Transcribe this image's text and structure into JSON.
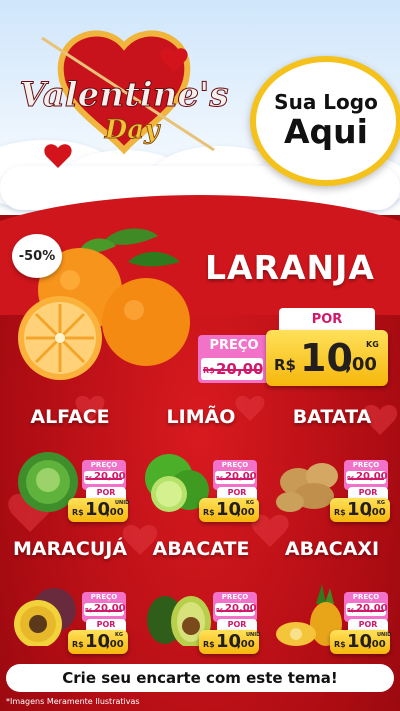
{
  "header": {
    "title_line1": "Valentine's",
    "title_line2": "Day",
    "logo_line1": "Sua Logo",
    "logo_line2": "Aqui"
  },
  "hero": {
    "discount": "-50%",
    "name": "LARANJA",
    "preco_label": "PREÇO",
    "old_currency": "R$",
    "old_price": "20,00",
    "por_label": "POR",
    "currency": "R$",
    "price_int": "10",
    "price_cents": ",00",
    "unit": "KG"
  },
  "products": [
    {
      "name": "ALFACE",
      "preco_label": "PREÇO",
      "old_currency": "R$",
      "old_price": "20,00",
      "por_label": "POR",
      "currency": "R$",
      "price_int": "10",
      "price_cents": ",00",
      "unit": "UNID",
      "icon": "lettuce-icon"
    },
    {
      "name": "LIMÃO",
      "preco_label": "PREÇO",
      "old_currency": "R$",
      "old_price": "20,00",
      "por_label": "POR",
      "currency": "R$",
      "price_int": "10",
      "price_cents": ",00",
      "unit": "KG",
      "icon": "lime-icon"
    },
    {
      "name": "BATATA",
      "preco_label": "PREÇO",
      "old_currency": "R$",
      "old_price": "20,00",
      "por_label": "POR",
      "currency": "R$",
      "price_int": "10",
      "price_cents": ",00",
      "unit": "KG",
      "icon": "potato-icon"
    },
    {
      "name": "MARACUJÁ",
      "preco_label": "PREÇO",
      "old_currency": "R$",
      "old_price": "20,00",
      "por_label": "POR",
      "currency": "R$",
      "price_int": "10",
      "price_cents": ",00",
      "unit": "KG",
      "icon": "passion-fruit-icon"
    },
    {
      "name": "ABACATE",
      "preco_label": "PREÇO",
      "old_currency": "R$",
      "old_price": "20,00",
      "por_label": "POR",
      "currency": "R$",
      "price_int": "10",
      "price_cents": ",00",
      "unit": "UNID",
      "icon": "avocado-icon"
    },
    {
      "name": "ABACAXI",
      "preco_label": "PREÇO",
      "old_currency": "R$",
      "old_price": "20,00",
      "por_label": "POR",
      "currency": "R$",
      "price_int": "10",
      "price_cents": ",00",
      "unit": "UNID",
      "icon": "pineapple-icon"
    }
  ],
  "footer": {
    "cta": "Crie seu encarte com este tema!",
    "note": "*Imagens Meramente Ilustrativas"
  },
  "colors": {
    "background_red": "#b10d14",
    "pink_tag": "#f271c9",
    "price_yellow": "#f6b70c",
    "logo_ring": "#f5c21b"
  }
}
